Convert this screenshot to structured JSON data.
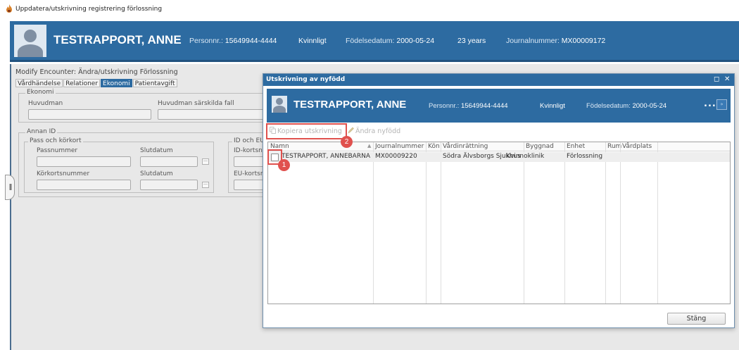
{
  "window": {
    "title": "Uppdatera/utskrivning registrering förlossning",
    "app_icon": "flame-icon"
  },
  "patient_banner": {
    "name": "TESTRAPPORT, ANNE",
    "personnr_label": "Personnr.:",
    "personnr": "15649944-4444",
    "gender": "Kvinnligt",
    "birth_label": "Födelsedatum:",
    "birth_date": "2000-05-24",
    "age": "23 years",
    "journal_label": "Journalnummer:",
    "journal_number": "MX00009172"
  },
  "encounter": {
    "title": "Modify Encounter: Ändra/utskrivning Förlossning",
    "tabs": [
      {
        "label": "Vårdhändelse",
        "active": false
      },
      {
        "label": "Relationer",
        "active": false
      },
      {
        "label": "Ekonomi",
        "active": true
      },
      {
        "label": "Patientavgift",
        "active": false
      }
    ]
  },
  "form": {
    "economy_legend": "Ekonomi",
    "huvudman_label": "Huvudman",
    "huvudman_special_label": "Huvudman särskilda fall",
    "other_id_legend": "Annan ID",
    "passport_legend": "Pass och körkort",
    "passport_number_label": "Passnummer",
    "passport_end_label": "Slutdatum",
    "license_number_label": "Körkortsnummer",
    "license_end_label": "Slutdatum",
    "eu_legend": "ID och EU",
    "id_card_label": "ID-kortsn",
    "eu_card_label": "EU-kortsn"
  },
  "dialog": {
    "title": "Utskrivning av nyfödd",
    "controls": {
      "restore": "◻",
      "close": "✕"
    },
    "banner": {
      "name": "TESTRAPPORT, ANNE",
      "personnr_label": "Personnr.:",
      "personnr": "15649944-4444",
      "gender": "Kvinnligt",
      "birth_label": "Födelsedatum:",
      "birth_date": "2000-05-24",
      "more": "..."
    },
    "toolbar": {
      "copy_label": "Kopiera utskrivning",
      "edit_label": "Ändra nyfödd"
    },
    "grid": {
      "columns": [
        "Namn",
        "Journalnummer",
        "Kön",
        "Vårdinrättning",
        "Byggnad",
        "Enhet",
        "Rum",
        "Vårdplats"
      ],
      "rows": [
        {
          "name": "TESTRAPPORT, ANNEBARNA",
          "journal": "MX00009220",
          "gender": "",
          "facility": "Södra Älvsborgs Sjukhus",
          "building": "Kvinnoklinik",
          "unit": "Förlossning",
          "room": "",
          "bed": ""
        }
      ]
    },
    "close_label": "Stäng"
  },
  "annotations": [
    {
      "number": "1"
    },
    {
      "number": "2"
    }
  ],
  "colors": {
    "banner_blue": "#2d6ba1",
    "callout_red": "#e0514e",
    "panel_gray": "#e8e8e8"
  }
}
